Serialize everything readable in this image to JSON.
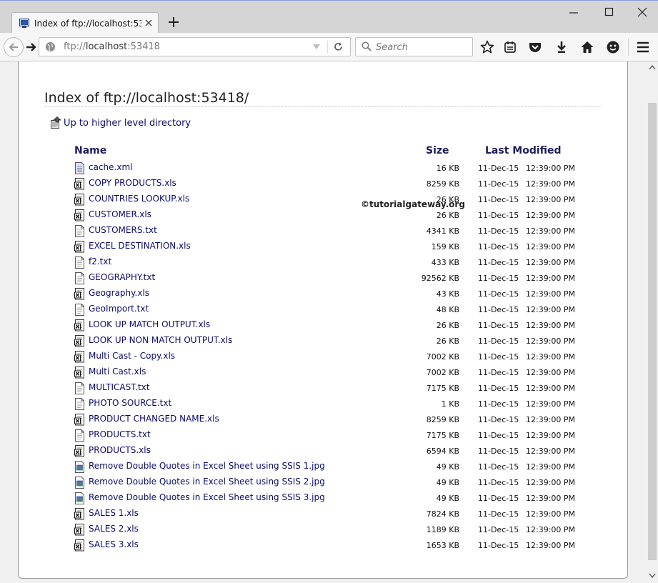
{
  "browser": {
    "tab": {
      "title": "Index of ftp://localhost:53..."
    },
    "url": {
      "prefix": "ftp://",
      "host": "localhost",
      "port": ":53418"
    },
    "search": {
      "placeholder": "Search"
    }
  },
  "page": {
    "title": "Index of ftp://localhost:53418/",
    "up_link": "Up to higher level directory",
    "columns": {
      "name": "Name",
      "size": "Size",
      "modified": "Last Modified"
    },
    "watermark": "©tutorialgateway.org"
  },
  "files": [
    {
      "name": "cache.xml",
      "icon": "xml-file-icon",
      "size": "16 KB",
      "date": "11-Dec-15",
      "time": "12:39:00 PM"
    },
    {
      "name": "COPY PRODUCTS.xls",
      "icon": "excel-file-icon",
      "size": "8259 KB",
      "date": "11-Dec-15",
      "time": "12:39:00 PM"
    },
    {
      "name": "COUNTRIES LOOKUP.xls",
      "icon": "excel-file-icon",
      "size": "26 KB",
      "date": "11-Dec-15",
      "time": "12:39:00 PM"
    },
    {
      "name": "CUSTOMER.xls",
      "icon": "excel-file-icon",
      "size": "26 KB",
      "date": "11-Dec-15",
      "time": "12:39:00 PM"
    },
    {
      "name": "CUSTOMERS.txt",
      "icon": "text-file-icon",
      "size": "4341 KB",
      "date": "11-Dec-15",
      "time": "12:39:00 PM"
    },
    {
      "name": "EXCEL DESTINATION.xls",
      "icon": "excel-file-icon",
      "size": "159 KB",
      "date": "11-Dec-15",
      "time": "12:39:00 PM"
    },
    {
      "name": "f2.txt",
      "icon": "text-file-icon",
      "size": "433 KB",
      "date": "11-Dec-15",
      "time": "12:39:00 PM"
    },
    {
      "name": "GEOGRAPHY.txt",
      "icon": "text-file-icon",
      "size": "92562 KB",
      "date": "11-Dec-15",
      "time": "12:39:00 PM"
    },
    {
      "name": "Geography.xls",
      "icon": "excel-file-icon",
      "size": "43 KB",
      "date": "11-Dec-15",
      "time": "12:39:00 PM"
    },
    {
      "name": "GeoImport.txt",
      "icon": "text-file-icon",
      "size": "48 KB",
      "date": "11-Dec-15",
      "time": "12:39:00 PM"
    },
    {
      "name": "LOOK UP MATCH OUTPUT.xls",
      "icon": "excel-file-icon",
      "size": "26 KB",
      "date": "11-Dec-15",
      "time": "12:39:00 PM"
    },
    {
      "name": "LOOK UP NON MATCH OUTPUT.xls",
      "icon": "excel-file-icon",
      "size": "26 KB",
      "date": "11-Dec-15",
      "time": "12:39:00 PM"
    },
    {
      "name": "Multi Cast - Copy.xls",
      "icon": "excel-file-icon",
      "size": "7002 KB",
      "date": "11-Dec-15",
      "time": "12:39:00 PM"
    },
    {
      "name": "Multi Cast.xls",
      "icon": "excel-file-icon",
      "size": "7002 KB",
      "date": "11-Dec-15",
      "time": "12:39:00 PM"
    },
    {
      "name": "MULTICAST.txt",
      "icon": "text-file-icon",
      "size": "7175 KB",
      "date": "11-Dec-15",
      "time": "12:39:00 PM"
    },
    {
      "name": "PHOTO SOURCE.txt",
      "icon": "text-file-icon",
      "size": "1 KB",
      "date": "11-Dec-15",
      "time": "12:39:00 PM"
    },
    {
      "name": "PRODUCT CHANGED NAME.xls",
      "icon": "excel-file-icon",
      "size": "8259 KB",
      "date": "11-Dec-15",
      "time": "12:39:00 PM"
    },
    {
      "name": "PRODUCTS.txt",
      "icon": "text-file-icon",
      "size": "7175 KB",
      "date": "11-Dec-15",
      "time": "12:39:00 PM"
    },
    {
      "name": "PRODUCTS.xls",
      "icon": "excel-file-icon",
      "size": "6594 KB",
      "date": "11-Dec-15",
      "time": "12:39:00 PM"
    },
    {
      "name": "Remove Double Quotes in Excel Sheet using SSIS 1.jpg",
      "icon": "image-file-icon",
      "size": "49 KB",
      "date": "11-Dec-15",
      "time": "12:39:00 PM"
    },
    {
      "name": "Remove Double Quotes in Excel Sheet using SSIS 2.jpg",
      "icon": "image-file-icon",
      "size": "49 KB",
      "date": "11-Dec-15",
      "time": "12:39:00 PM"
    },
    {
      "name": "Remove Double Quotes in Excel Sheet using SSIS 3.jpg",
      "icon": "image-file-icon",
      "size": "49 KB",
      "date": "11-Dec-15",
      "time": "12:39:00 PM"
    },
    {
      "name": "SALES 1.xls",
      "icon": "excel-file-icon",
      "size": "7824 KB",
      "date": "11-Dec-15",
      "time": "12:39:00 PM"
    },
    {
      "name": "SALES 2.xls",
      "icon": "excel-file-icon",
      "size": "1189 KB",
      "date": "11-Dec-15",
      "time": "12:39:00 PM"
    },
    {
      "name": "SALES 3.xls",
      "icon": "excel-file-icon",
      "size": "1653 KB",
      "date": "11-Dec-15",
      "time": "12:39:00 PM"
    }
  ]
}
